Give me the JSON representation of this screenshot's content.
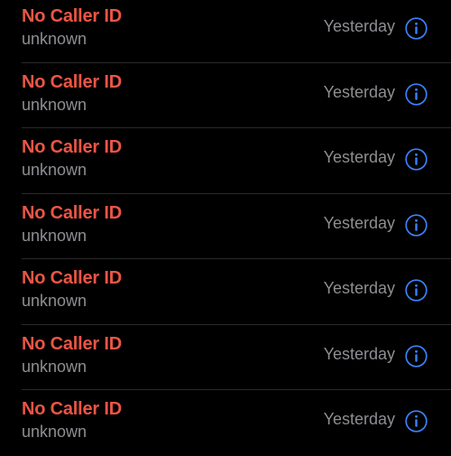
{
  "colors": {
    "background": "#000000",
    "missed_call_red": "#eb5545",
    "secondary_gray": "#8e8e93",
    "accent_blue": "#3b82f6",
    "divider": "#2a2a2c"
  },
  "calls": [
    {
      "name": "No Caller ID",
      "label": "unknown",
      "time": "Yesterday",
      "icon": "info-icon"
    },
    {
      "name": "No Caller ID",
      "label": "unknown",
      "time": "Yesterday",
      "icon": "info-icon"
    },
    {
      "name": "No Caller ID",
      "label": "unknown",
      "time": "Yesterday",
      "icon": "info-icon"
    },
    {
      "name": "No Caller ID",
      "label": "unknown",
      "time": "Yesterday",
      "icon": "info-icon"
    },
    {
      "name": "No Caller ID",
      "label": "unknown",
      "time": "Yesterday",
      "icon": "info-icon"
    },
    {
      "name": "No Caller ID",
      "label": "unknown",
      "time": "Yesterday",
      "icon": "info-icon"
    },
    {
      "name": "No Caller ID",
      "label": "unknown",
      "time": "Yesterday",
      "icon": "info-icon"
    }
  ]
}
